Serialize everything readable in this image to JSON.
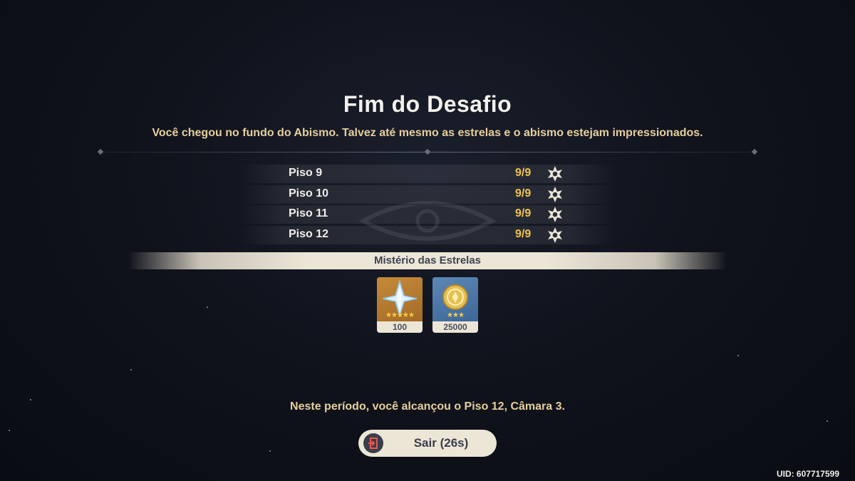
{
  "header": {
    "title": "Fim do Desafio",
    "subtitle": "Você chegou no fundo do Abismo. Talvez até mesmo as estrelas e o abismo estejam impressionados."
  },
  "floors": [
    {
      "name": "Piso 9",
      "score": "9/9",
      "icon": "abyss-star-icon"
    },
    {
      "name": "Piso 10",
      "score": "9/9",
      "icon": "abyss-star-icon"
    },
    {
      "name": "Piso 11",
      "score": "9/9",
      "icon": "abyss-star-icon"
    },
    {
      "name": "Piso 12",
      "score": "9/9",
      "icon": "abyss-star-icon"
    }
  ],
  "rewards_section": {
    "label": "Mistério das Estrelas",
    "items": [
      {
        "icon": "primogem-icon",
        "rarity": 5,
        "count": "100",
        "background": "#b8782e"
      },
      {
        "icon": "mora-icon",
        "rarity": 3,
        "count": "25000",
        "background": "#4a78a6"
      }
    ]
  },
  "footer": {
    "period_text": "Neste período, você alcançou o Piso 12, Câmara 3.",
    "exit_label": "Sair (26s)",
    "exit_icon": "exit-door-icon",
    "uid": "UID: 607717599"
  },
  "colors": {
    "accent_gold": "#f1c44a",
    "text_cream": "#e6cf9c",
    "panel_light": "#ece6d7",
    "dark_text": "#3a3d4b"
  }
}
